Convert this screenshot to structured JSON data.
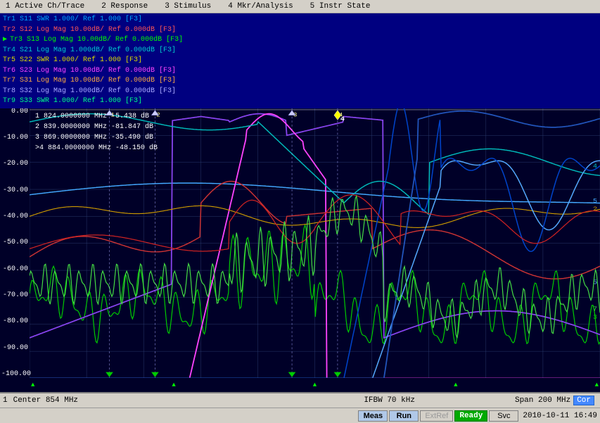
{
  "menu": {
    "items": [
      {
        "label": "1 Active Ch/Trace"
      },
      {
        "label": "2 Response"
      },
      {
        "label": "3 Stimulus"
      },
      {
        "label": "4 Mkr/Analysis"
      },
      {
        "label": "5 Instr State"
      }
    ]
  },
  "traces": [
    {
      "id": "Tr1",
      "active": false,
      "color": "#00aaff",
      "label": "Tr1 S11 SWR 1.000/ Ref 1.000 [F3]"
    },
    {
      "id": "Tr2",
      "active": false,
      "color": "#ff4444",
      "label": "Tr2 S12 Log Mag 10.00dB/ Ref 0.000dB [F3]"
    },
    {
      "id": "Tr3",
      "active": true,
      "color": "#00ff00",
      "label": "Tr3 S13 Log Mag 10.00dB/ Ref 0.000dB [F3]"
    },
    {
      "id": "Tr4",
      "active": false,
      "color": "#00cccc",
      "label": "Tr4 S21 Log Mag 1.000dB/ Ref 0.000dB [F3]"
    },
    {
      "id": "Tr5",
      "active": false,
      "color": "#ffff00",
      "label": "Tr5 S22 SWR 1.000/ Ref 1.000 [F3]"
    },
    {
      "id": "Tr6",
      "active": false,
      "color": "#ff00ff",
      "label": "Tr6 S23 Log Mag 10.00dB/ Ref 0.000dB [F3]"
    },
    {
      "id": "Tr7",
      "active": false,
      "color": "#ff8800",
      "label": "Tr7 S31 Log Mag 10.00dB/ Ref 0.000dB [F3]"
    },
    {
      "id": "Tr8",
      "active": false,
      "color": "#aaaaff",
      "label": "Tr8 S32 Log Mag 1.000dB/ Ref 0.000dB [F3]"
    },
    {
      "id": "Tr9",
      "active": false,
      "color": "#00ff88",
      "label": "Tr9 S33 SWR 1.000/ Ref 1.000 [F3]"
    }
  ],
  "markers": [
    {
      "num": 1,
      "freq": "824.0000000 MHz",
      "value": "-5.438 dB"
    },
    {
      "num": 2,
      "freq": "839.0000000 MHz",
      "value": "-81.847 dB"
    },
    {
      "num": 3,
      "freq": "869.0000000 MHz",
      "value": "-35.490 dB"
    },
    {
      "num": 4,
      "freq": "884.0000000 MHz",
      "value": "-48.150 dB"
    }
  ],
  "yAxis": {
    "labels": [
      "0.00",
      "-10.00",
      "-20.00",
      "-30.00",
      "-40.00",
      "-50.00",
      "-60.00",
      "-70.00",
      "-80.00",
      "-90.00",
      "-100.00"
    ],
    "refLine": 0,
    "scale": 10
  },
  "xAxis": {
    "markers": [
      "▲",
      "▲",
      "▲",
      "▲",
      "▲"
    ],
    "markerColors": [
      "#00ff00",
      "#00ff00",
      "#00ff00",
      "#00ff00",
      "#00ff00"
    ]
  },
  "statusBar": {
    "channel": "1",
    "centerFreq": "Center 854 MHz",
    "ifbw": "IFBW 70 kHz",
    "span": "Span 200 MHz",
    "cor": "Cor",
    "meas": "Meas",
    "run": "Run",
    "extRef": "ExtRef",
    "ready": "Ready",
    "svc": "Svc",
    "datetime": "2010-10-11 16:49"
  },
  "chartColors": {
    "background": "#000020",
    "gridLine": "#2a3a6a",
    "refLine": "#ffffff"
  }
}
